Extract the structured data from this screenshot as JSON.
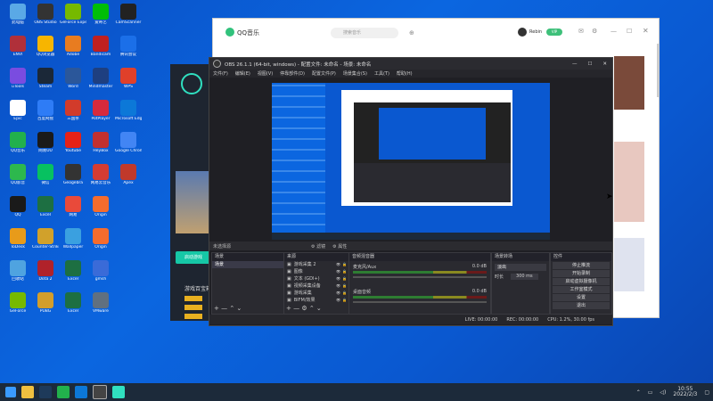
{
  "desktop": {
    "icons": [
      {
        "label": "此电脑",
        "color": "#5aa9e6"
      },
      {
        "label": "OBS Studio",
        "color": "#333"
      },
      {
        "label": "GeForce Experience",
        "color": "#76b900"
      },
      {
        "label": "爱奇艺",
        "color": "#00be06"
      },
      {
        "label": "CamScanner",
        "color": "#222"
      },
      {
        "label": "ENVI",
        "color": "#b0303a"
      },
      {
        "label": "QQ浏览器",
        "color": "#f7b500"
      },
      {
        "label": "Adobe",
        "color": "#e87c20"
      },
      {
        "label": "Bandicam",
        "color": "#c02020"
      },
      {
        "label": "腾讯会议",
        "color": "#1b6fe8"
      },
      {
        "label": "uTools",
        "color": "#7a4ce0"
      },
      {
        "label": "Steam",
        "color": "#1b2838"
      },
      {
        "label": "Word",
        "color": "#2b579a"
      },
      {
        "label": "Mindmaster",
        "color": "#1e3f80"
      },
      {
        "label": "WPS",
        "color": "#e0402a"
      },
      {
        "label": "Epic",
        "color": "#fff"
      },
      {
        "label": "百度网盘",
        "color": "#2e7cf6"
      },
      {
        "label": "三国杀",
        "color": "#d23b2b"
      },
      {
        "label": "PotPlayer",
        "color": "#d72a3c"
      },
      {
        "label": "Microsoft Edge",
        "color": "#0c78d8"
      },
      {
        "label": "QQ音乐",
        "color": "#22b14c"
      },
      {
        "label": "网易UU",
        "color": "#1a1a1a"
      },
      {
        "label": "Youtube",
        "color": "#e62117"
      },
      {
        "label": "HeyBox",
        "color": "#c2302f"
      },
      {
        "label": "Google Chrome",
        "color": "#4285f4"
      },
      {
        "label": "QQ影音",
        "color": "#2db84d"
      },
      {
        "label": "微信",
        "color": "#07c160"
      },
      {
        "label": "Geogebra",
        "color": "#333"
      },
      {
        "label": "网易云音乐",
        "color": "#d43c33"
      },
      {
        "label": "Apex",
        "color": "#c0392b"
      },
      {
        "label": "QQ",
        "color": "#1a1a1a"
      },
      {
        "label": "Excel",
        "color": "#1d6f42"
      },
      {
        "label": "网易",
        "color": "#e94a3a"
      },
      {
        "label": "Origin",
        "color": "#f56c2d"
      },
      {
        "label": "ToDesk",
        "color": "#e89b1a"
      },
      {
        "label": "Counter-Strike",
        "color": "#d1a12b"
      },
      {
        "label": "Wallpaper",
        "color": "#3aa0e0"
      },
      {
        "label": "Origin",
        "color": "#f56c2d"
      },
      {
        "label": "回收站",
        "color": "#4fa3e0"
      },
      {
        "label": "Dota 2",
        "color": "#b0222a"
      },
      {
        "label": "Excel",
        "color": "#1d6f42"
      },
      {
        "label": "gmsh",
        "color": "#3a6bd8"
      },
      {
        "label": "GeForce",
        "color": "#76b900"
      },
      {
        "label": "PUBG",
        "color": "#d29e2b"
      },
      {
        "label": "Excel",
        "color": "#1d6f42"
      },
      {
        "label": "VMware",
        "color": "#607080"
      }
    ]
  },
  "qqmusic": {
    "brand": "QQ音乐",
    "search_placeholder": "搜索音乐",
    "user": "Rebin",
    "vip": "VIP"
  },
  "game": {
    "button": "启动游戏",
    "heading": "游戏百宝箱",
    "links": [
      "#",
      "#",
      "#"
    ]
  },
  "obs": {
    "title": "OBS 26.1.1 (64-bit, windows) - 配置文件: 未命名 - 场景: 未命名",
    "menu": [
      "文件(F)",
      "编辑(E)",
      "视图(V)",
      "停靠部件(D)",
      "配置文件(P)",
      "场景集合(S)",
      "工具(T)",
      "帮助(H)"
    ],
    "tabs": {
      "filter": "滤镜",
      "properties": "属性"
    },
    "no_source": "未选择源",
    "docks": {
      "scenes": "场景",
      "sources": "来源",
      "mixer": "音频混音器",
      "transitions": "场景转场",
      "controls": "控件"
    },
    "scene_items": [
      "场景"
    ],
    "source_items": [
      "游戏采集 2",
      "图像",
      "文本 (GDI+)",
      "视频采集设备",
      "游戏采集",
      "BIFM/效果"
    ],
    "mixer": [
      {
        "name": "桌面音频",
        "db": "0.0 dB"
      },
      {
        "name": "麦克风/Aux",
        "db": "0.0 dB"
      }
    ],
    "transition": {
      "type": "淡出",
      "duration_label": "时长",
      "duration": "300 ms"
    },
    "controls": [
      "停止推流",
      "开始录制",
      "启动虚拟摄像机",
      "工作室模式",
      "设置",
      "退出"
    ],
    "status": {
      "live": "LIVE: 00:00:00",
      "rec": "REC: 00:00:00",
      "cpu": "CPU: 1.2%, 30.00 fps"
    }
  },
  "taskbar": {
    "time": "10:55",
    "date": "2022/2/3"
  }
}
